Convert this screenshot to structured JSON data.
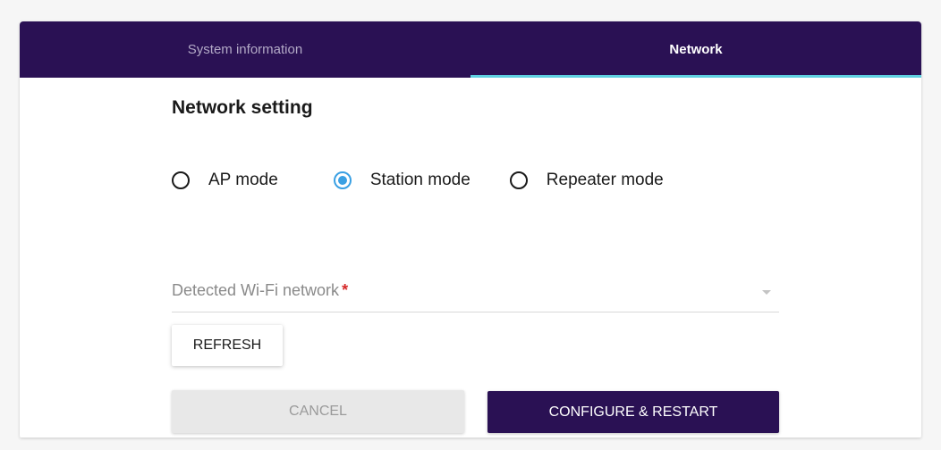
{
  "tabs": [
    {
      "label": "System information",
      "active": false
    },
    {
      "label": "Network",
      "active": true
    }
  ],
  "network": {
    "title": "Network setting",
    "modes": [
      {
        "label": "AP mode",
        "checked": false
      },
      {
        "label": "Station mode",
        "checked": true
      },
      {
        "label": "Repeater mode",
        "checked": false
      }
    ],
    "wifi_field": {
      "label": "Detected Wi-Fi network",
      "required_mark": "*",
      "value": ""
    },
    "refresh_label": "REFRESH",
    "cancel_label": "CANCEL",
    "configure_label": "CONFIGURE & RESTART"
  },
  "colors": {
    "header_bg": "#2a1154",
    "active_tab_indicator": "#5fd0e0",
    "radio_checked": "#3aa0e3",
    "required": "#d62a2a",
    "primary_button": "#2a1154"
  }
}
